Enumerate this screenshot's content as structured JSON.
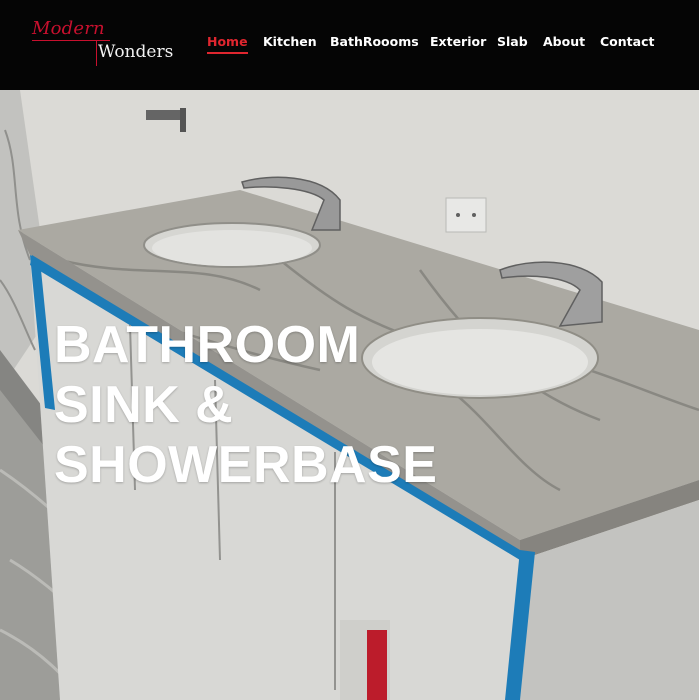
{
  "brand": {
    "top": "Modern",
    "bottom": "Wonders",
    "accent_color": "#c8102e"
  },
  "nav": {
    "items": [
      {
        "label": "Home",
        "active": true
      },
      {
        "label": "Kitchen"
      },
      {
        "label": "BathRoooms"
      },
      {
        "label": "Exterior"
      },
      {
        "label": "Slab"
      },
      {
        "label": "About"
      },
      {
        "label": "Contact"
      }
    ],
    "active_color": "#e0262f"
  },
  "hero": {
    "title_lines": [
      "BATHROOM",
      "SINK &",
      "SHOWERBASE"
    ],
    "image": "bathroom-vanity-double-sink-photo"
  }
}
